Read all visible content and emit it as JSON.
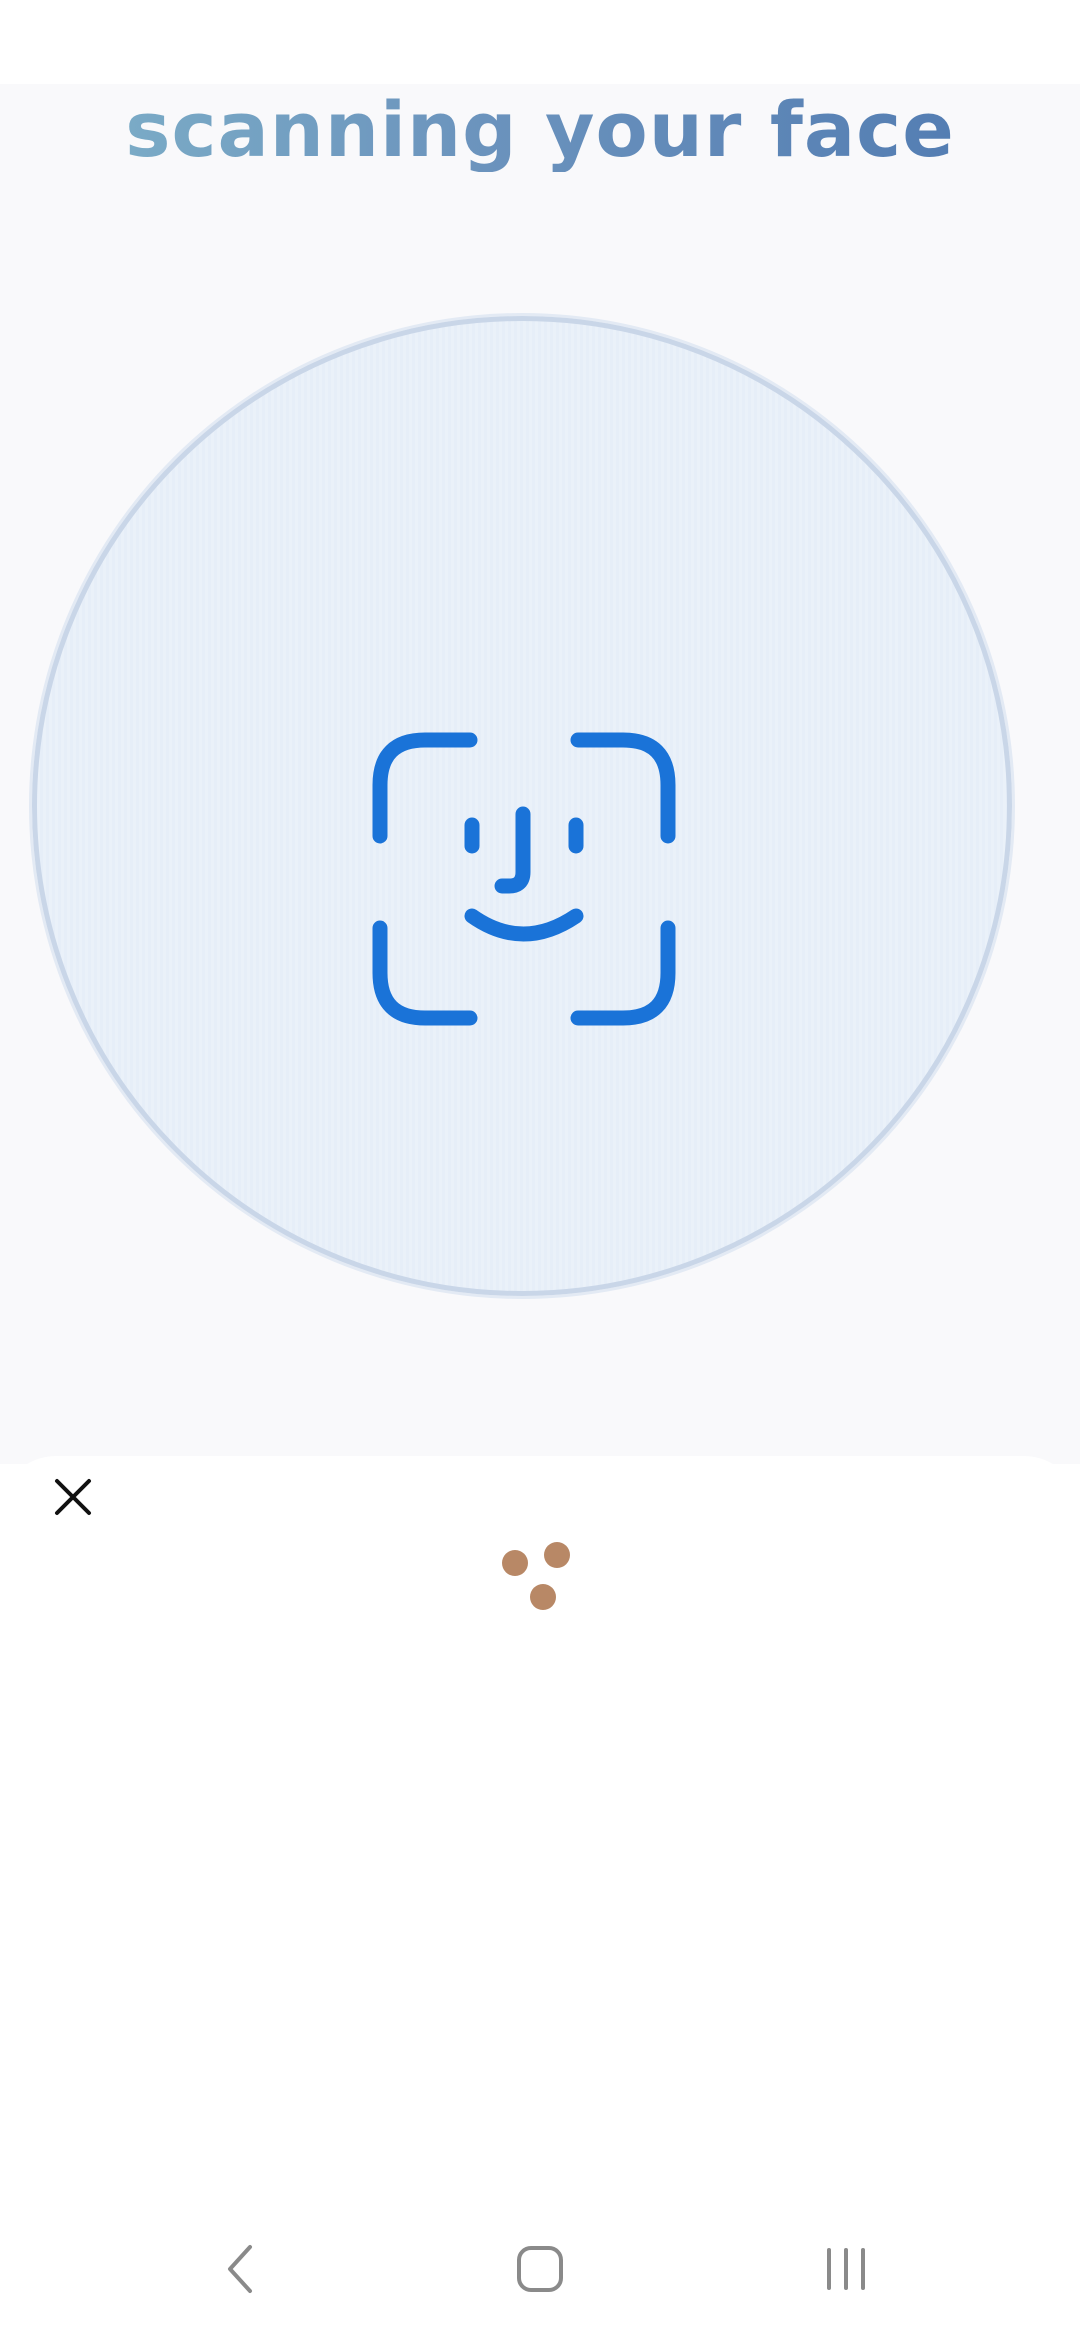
{
  "scan": {
    "title": "scanning your face"
  },
  "icons": {
    "face": "face-id-icon",
    "close": "close-icon",
    "loader": "loading-dots-icon",
    "back": "back-icon",
    "home": "home-icon",
    "recents": "recents-icon"
  },
  "colors": {
    "accent": "#1a73d8",
    "loader": "#b88866",
    "circle_border": "#c9d6e8"
  }
}
